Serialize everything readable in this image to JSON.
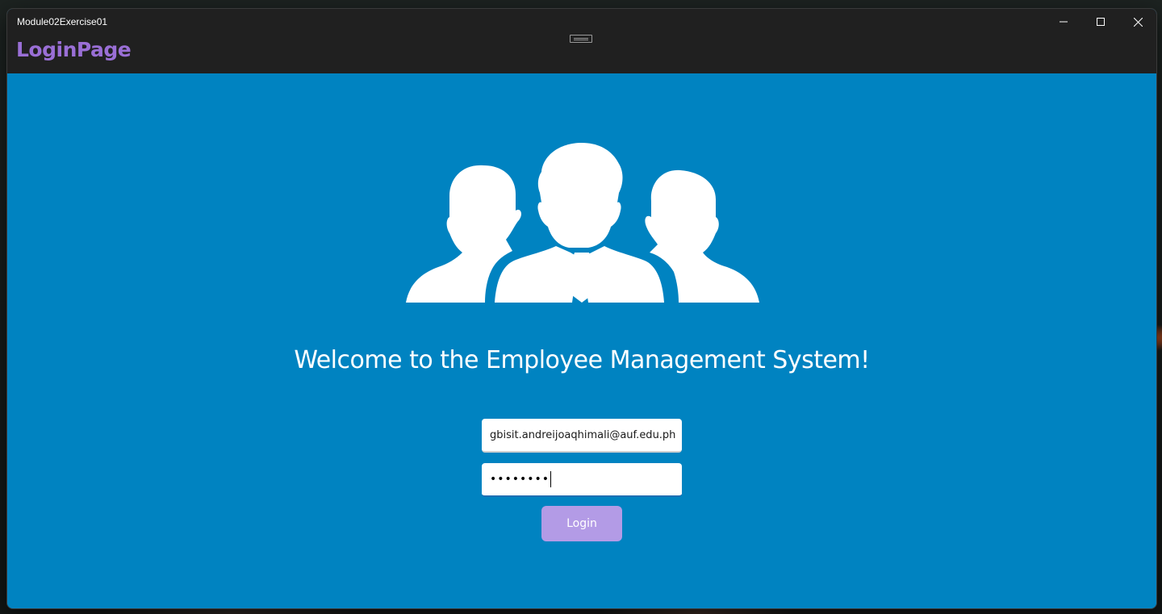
{
  "window": {
    "title": "Module02Exercise01",
    "controls": {
      "minimize_icon": "minimize-icon",
      "maximize_icon": "maximize-icon",
      "close_icon": "close-icon"
    }
  },
  "header": {
    "page_title": "LoginPage"
  },
  "main": {
    "hero_icon": "team-people-icon",
    "welcome_text": "Welcome to the Employee Management System!",
    "email_field": {
      "value": "gbisit.andreijoaqhimali@auf.edu.ph"
    },
    "password_field": {
      "masked_value": "••••••••"
    },
    "login_button_label": "Login"
  },
  "colors": {
    "background": "#0083c1",
    "titlebar": "#202020",
    "header_text": "#9a6fd6",
    "button": "#b39be6"
  }
}
